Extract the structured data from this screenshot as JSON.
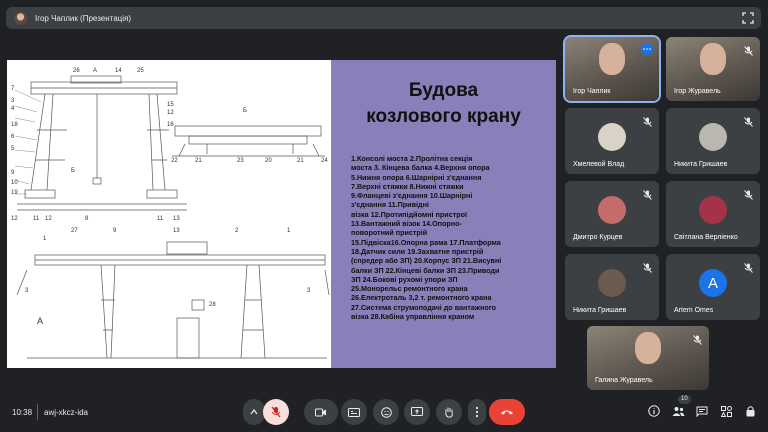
{
  "presenter_bar": {
    "title": "Ігор Чаплик (Презентація)",
    "icon": "fullscreen-icon"
  },
  "slide": {
    "title_line1": "Будова",
    "title_line2": "козлового крану",
    "items": [
      "1.Консолі моста 2.Пролітна секція",
      "моста  3. Кінцева балка 4.Верхня опора",
      "5.Нижня опора 6.Шарнірні з'єднання",
      "7.Верхні стяжки 8.Нижні стяжки",
      "9.Фланцеві з'єднання 10.Шарнірні",
      "з'єднання 11.Привідні",
      "візка  12.Протипідйомні пристрої",
      "13.Вантажний візок 14.Опорно-",
      "поворотний пристрій",
      "15.Підвіска16.Опорна рама 17.Платформа",
      "18.Датчик сили 19.Захватне пристрій",
      "(спредер або ЗП) 20.Корпус ЗП 21.Висувні",
      "балки ЗП 22.Кінцеві балки ЗП 23.Приводи",
      "ЗП 24.Бокові рухомі упори ЗП",
      "25.Монорельс ремонтного крана",
      "26.Електроталь 3,2 т. ремонтного крана",
      "27.Система струмоподачі до вантажного",
      "візка 28.Кабіна управління краном"
    ],
    "drawing_labels": {
      "top": [
        "26",
        "А",
        "14",
        "25"
      ],
      "left": [
        "7",
        "3",
        "4",
        "18",
        "6",
        "5",
        "9",
        "10",
        "19",
        "12"
      ],
      "right": [
        "15",
        "12",
        "16",
        "11",
        "13"
      ],
      "bottom_left": [
        "12",
        "11",
        "8",
        "11",
        "12"
      ],
      "b_view": [
        "Б",
        "22",
        "21",
        "23",
        "20",
        "21",
        "24"
      ],
      "mid": [
        "Б"
      ],
      "lower_top": [
        "1",
        "27",
        "9",
        "13",
        "2",
        "1"
      ],
      "lower_misc": [
        "3",
        "28",
        "3",
        "А"
      ]
    }
  },
  "participants": [
    {
      "name": "Ігор Чаплик",
      "type": "video",
      "active": true,
      "more": true
    },
    {
      "name": "Ігор Журавель",
      "type": "video",
      "muted": true
    },
    {
      "name": "Хмелевой Влад",
      "type": "avatar",
      "muted": true,
      "avatar_color": "#d9d2c7"
    },
    {
      "name": "Никита Гришаев",
      "type": "avatar",
      "muted": true,
      "avatar_color": "#b9b7b0"
    },
    {
      "name": "Дмитро Курцев",
      "type": "avatar",
      "muted": true,
      "avatar_color": "#c46b6b"
    },
    {
      "name": "Світлана Верліенко",
      "type": "avatar",
      "muted": true,
      "avatar_color": "#a4334a"
    },
    {
      "name": "Никита Гришаев",
      "type": "avatar",
      "muted": true,
      "avatar_color": "#6b5a4e"
    },
    {
      "name": "Artem Omes",
      "type": "letter",
      "letter": "A",
      "muted": true,
      "avatar_color": "#1a73e8"
    },
    {
      "name": "Галина Журавель",
      "type": "video",
      "muted": true
    }
  ],
  "bottom_bar": {
    "time": "10:38",
    "separator": "|",
    "meeting_code": "awj-xkcz-ida",
    "people_count": "10",
    "controls": [
      "chevron-up-icon",
      "mic-off-icon",
      "camera-icon",
      "captions-icon",
      "emoji-icon",
      "present-icon",
      "raise-hand-icon",
      "more-options-icon",
      "end-call-icon"
    ],
    "right_icons": [
      "info-icon",
      "people-icon",
      "chat-icon",
      "activities-icon",
      "lock-icon"
    ]
  },
  "colors": {
    "background": "#202124",
    "panel": "#3c4043",
    "slide_panel": "#8a7fb8",
    "end_call": "#ea4335",
    "accent": "#8ab4f8"
  }
}
